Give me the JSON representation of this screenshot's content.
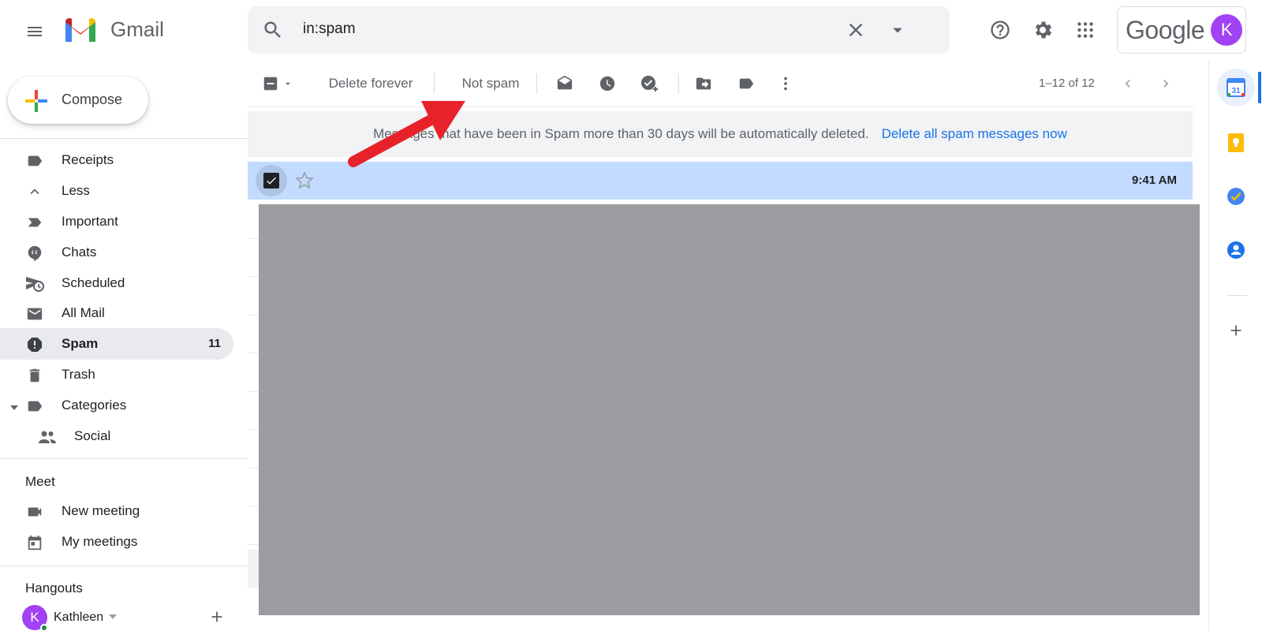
{
  "header": {
    "logo_text": "Gmail",
    "search_value": "in:spam",
    "account_word": "Google",
    "account_initial": "K"
  },
  "sidebar": {
    "compose_label": "Compose",
    "items": [
      {
        "label": "Receipts",
        "icon": "label-icon"
      },
      {
        "label": "Less",
        "icon": "chevron-up-icon"
      },
      {
        "label": "Important",
        "icon": "important-icon"
      },
      {
        "label": "Chats",
        "icon": "chat-icon"
      },
      {
        "label": "Scheduled",
        "icon": "scheduled-send-icon"
      },
      {
        "label": "All Mail",
        "icon": "mail-icon"
      },
      {
        "label": "Spam",
        "icon": "spam-icon",
        "count": "11",
        "active": true
      },
      {
        "label": "Trash",
        "icon": "trash-icon"
      },
      {
        "label": "Categories",
        "icon": "label-icon"
      },
      {
        "label": "Social",
        "icon": "people-icon"
      }
    ],
    "meet": {
      "title": "Meet",
      "items": [
        {
          "label": "New meeting",
          "icon": "video-icon"
        },
        {
          "label": "My meetings",
          "icon": "calendar-icon"
        }
      ]
    },
    "hangouts": {
      "title": "Hangouts",
      "user_name": "Kathleen",
      "user_initial": "K"
    }
  },
  "toolbar": {
    "delete_forever": "Delete forever",
    "not_spam": "Not spam",
    "pagination": "1–12 of 12"
  },
  "notice": {
    "text": "Messages that have been in Spam more than 30 days will be automatically deleted.",
    "link": "Delete all spam messages now"
  },
  "selected_row": {
    "time": "9:41 AM"
  },
  "colors": {
    "accent": "#1a73e8",
    "selected_row": "#c2dbff",
    "redacted": "#9b9c9f",
    "annotation_arrow": "#e8222a"
  }
}
